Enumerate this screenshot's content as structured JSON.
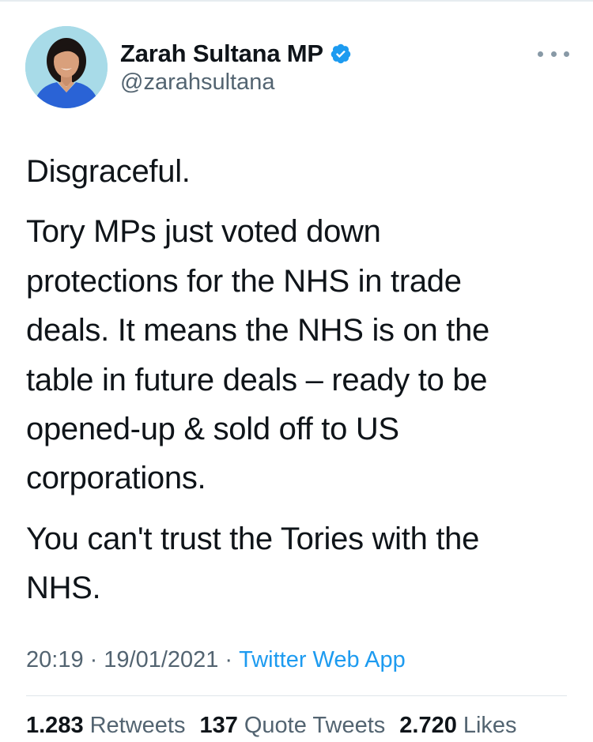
{
  "author": {
    "display_name": "Zarah Sultana MP",
    "handle": "@zarahsultana",
    "verified": true,
    "avatar_icon": "profile-photo"
  },
  "more_icon": "more-options-icon",
  "tweet": {
    "paragraphs": [
      [
        "Disgraceful."
      ],
      [
        "Tory MPs just voted down",
        "protections for the NHS in trade",
        "deals. It means the NHS is on the",
        "table in future deals – ready to be",
        "opened-up & sold off to US",
        "corporations."
      ],
      [
        "You can't trust the Tories with the",
        "NHS."
      ]
    ]
  },
  "meta": {
    "time": "20:19",
    "separator": "·",
    "date": "19/01/2021",
    "source": "Twitter Web App"
  },
  "stats": {
    "retweets": {
      "count": "1.283",
      "label": "Retweets"
    },
    "quotes": {
      "count": "137",
      "label": "Quote Tweets"
    },
    "likes": {
      "count": "2.720",
      "label": "Likes"
    }
  },
  "colors": {
    "accent": "#1d9bf0",
    "text_primary": "#0f1419",
    "text_secondary": "#536471"
  }
}
